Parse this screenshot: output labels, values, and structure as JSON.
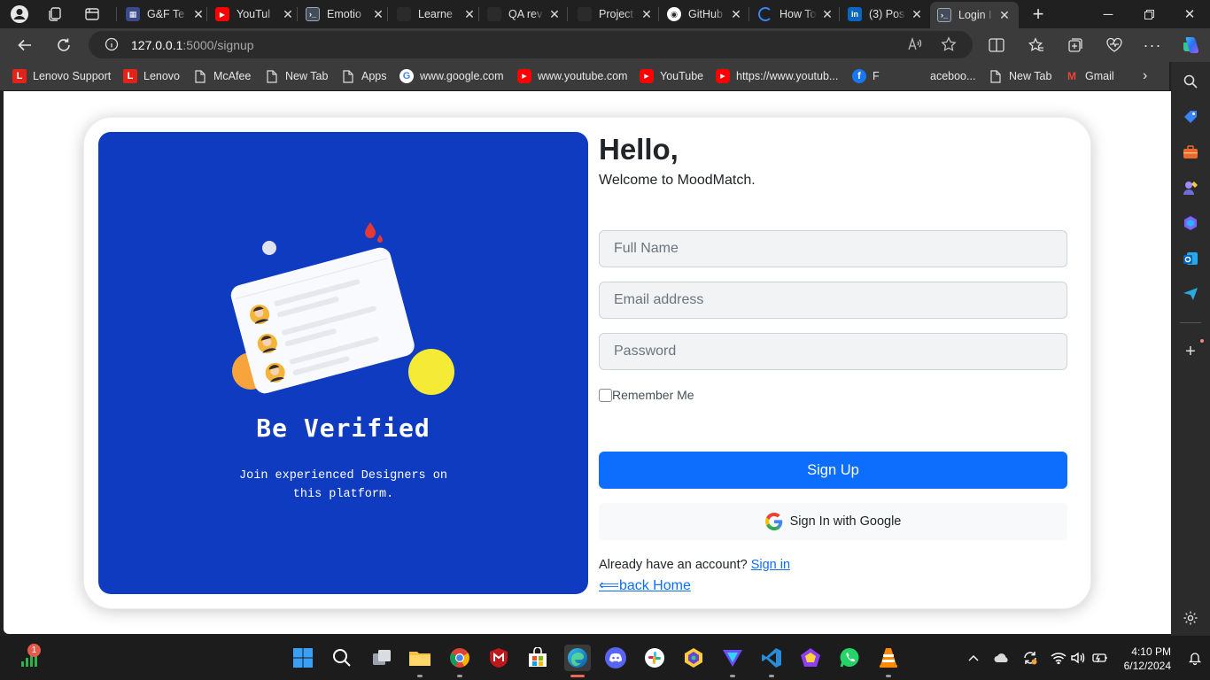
{
  "browser": {
    "tabs": [
      {
        "title": "G&F Te",
        "fav_color": "#3b4a8a",
        "fav_glyph": "▦"
      },
      {
        "title": "YouTul",
        "fav_color": "#ff0000",
        "fav_glyph": "▶"
      },
      {
        "title": "Emotio",
        "fav_color": "#444c5c",
        "fav_glyph": ">_"
      },
      {
        "title": "Learne",
        "fav_color": "#2b2b2b",
        "fav_glyph": ""
      },
      {
        "title": "QA rev",
        "fav_color": "#2b2b2b",
        "fav_glyph": ""
      },
      {
        "title": "Project",
        "fav_color": "#2b2b2b",
        "fav_glyph": ""
      },
      {
        "title": "GitHub",
        "fav_color": "#24292e",
        "fav_glyph": "◉"
      },
      {
        "title": "How To",
        "fav_color": "#0078d4",
        "fav_glyph": "◌"
      },
      {
        "title": "(3) Pos",
        "fav_color": "#0a66c2",
        "fav_glyph": "in"
      },
      {
        "title": "Login I",
        "fav_color": "#444c5c",
        "fav_glyph": ">_",
        "active": true
      }
    ],
    "url_host": "127.0.0.1",
    "url_path": ":5000/signup",
    "bookmarks": [
      {
        "label": "Lenovo Support",
        "icon": "lenovo-icon",
        "glyph": "L",
        "color": "#e2231a"
      },
      {
        "label": "Lenovo",
        "icon": "lenovo-icon",
        "glyph": "L",
        "color": "#e2231a"
      },
      {
        "label": "McAfee",
        "icon": "page-icon",
        "glyph": "",
        "color": ""
      },
      {
        "label": "New Tab",
        "icon": "page-icon",
        "glyph": "",
        "color": ""
      },
      {
        "label": "Apps",
        "icon": "page-icon",
        "glyph": "",
        "color": ""
      },
      {
        "label": "www.google.com",
        "icon": "google-icon",
        "glyph": "G",
        "color": "#ffffff"
      },
      {
        "label": "www.youtube.com",
        "icon": "youtube-icon",
        "glyph": "▶",
        "color": "#ff0000"
      },
      {
        "label": "YouTube",
        "icon": "youtube-icon",
        "glyph": "▶",
        "color": "#ff0000"
      },
      {
        "label": "https://www.youtub...",
        "icon": "youtube-icon",
        "glyph": "▶",
        "color": "#ff0000"
      },
      {
        "label": "F",
        "icon": "facebook-icon",
        "glyph": "f",
        "color": "#1877f2"
      },
      {
        "label": "aceboo...",
        "icon": "",
        "glyph": "",
        "color": ""
      },
      {
        "label": "New Tab",
        "icon": "page-icon",
        "glyph": "",
        "color": ""
      },
      {
        "label": "Gmail",
        "icon": "gmail-icon",
        "glyph": "M",
        "color": "#ea4335"
      }
    ]
  },
  "page": {
    "hero_title": "Be Verified",
    "hero_subtitle": "Join experienced Designers on this platform.",
    "greeting": "Hello,",
    "welcome": "Welcome to MoodMatch.",
    "full_name_placeholder": "Full Name",
    "email_placeholder": "Email address",
    "password_placeholder": "Password",
    "remember_label": "Remember Me",
    "signup_label": "Sign Up",
    "google_label": "Sign In with Google",
    "have_account_text": "Already have an account?",
    "signin_link": "Sign in",
    "back_home": "⟸back Home",
    "colors": {
      "hero_bg": "#0f3bc1",
      "primary": "#0d6efd"
    }
  },
  "taskbar": {
    "notification_count": "1",
    "time": "4:10 PM",
    "date": "6/12/2024"
  }
}
